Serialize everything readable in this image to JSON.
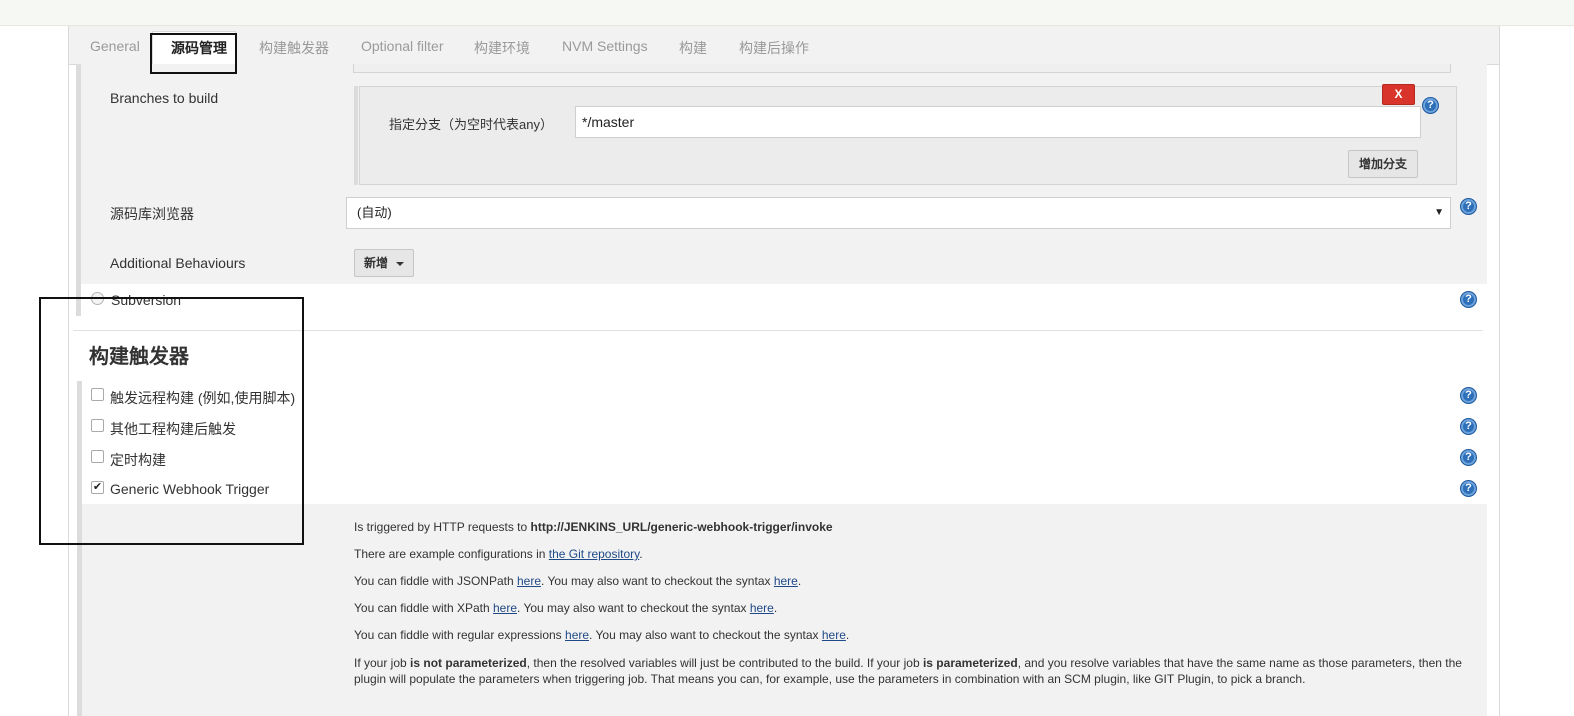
{
  "tabs": [
    {
      "label": "General",
      "active": false
    },
    {
      "label": "源码管理",
      "active": true
    },
    {
      "label": "构建触发器",
      "active": false
    },
    {
      "label": "Optional filter",
      "active": false
    },
    {
      "label": "构建环境",
      "active": false
    },
    {
      "label": "NVM Settings",
      "active": false
    },
    {
      "label": "构建",
      "active": false
    },
    {
      "label": "构建后操作",
      "active": false
    }
  ],
  "scm": {
    "branches_label": "Branches to build",
    "delete_button": "X",
    "branch_spec_label": "指定分支（为空时代表any）",
    "branch_spec_value": "*/master",
    "add_branch_button": "增加分支",
    "repo_browser_label": "源码库浏览器",
    "repo_browser_value": "(自动)",
    "additional_behaviours_label": "Additional Behaviours",
    "add_button": "新增",
    "subversion_label": "Subversion",
    "subversion_selected": false
  },
  "triggers": {
    "title": "构建触发器",
    "items": [
      {
        "label": "触发远程构建 (例如,使用脚本)",
        "checked": false
      },
      {
        "label": "其他工程构建后触发",
        "checked": false
      },
      {
        "label": "定时构建",
        "checked": false
      },
      {
        "label": "Generic Webhook Trigger",
        "checked": true
      }
    ]
  },
  "webhook_info": {
    "line1_prefix": "Is triggered by HTTP requests to ",
    "line1_url": "http://JENKINS_URL/generic-webhook-trigger/invoke",
    "line2_prefix": "There are example configurations in ",
    "line2_link": "the Git repository",
    "line2_suffix": ".",
    "line3_prefix": "You can fiddle with JSONPath ",
    "line3_link1": "here",
    "line3_mid": ". You may also want to checkout the syntax ",
    "line3_link2": "here",
    "line3_suffix": ".",
    "line4_prefix": "You can fiddle with XPath ",
    "line4_link1": "here",
    "line4_mid": ". You may also want to checkout the syntax ",
    "line4_link2": "here",
    "line4_suffix": ".",
    "line5_prefix": "You can fiddle with regular expressions ",
    "line5_link1": "here",
    "line5_mid": ". You may also want to checkout the syntax ",
    "line5_link2": "here",
    "line5_suffix": ".",
    "line6_a": "If your job ",
    "line6_b": "is not parameterized",
    "line6_c": ", then the resolved variables will just be contributed to the build. If your job ",
    "line6_d": "is parameterized",
    "line6_e": ", and you resolve variables that have the same name as those parameters, then the plugin will populate the parameters when triggering job. That means you can, for example, use the parameters in combination with an SCM plugin, like GIT Plugin, to pick a branch."
  },
  "help_icon_glyph": "?",
  "colors": {
    "delete_button": "#d9342b",
    "help_icon": "#2d6fb8",
    "link": "#204a87",
    "section_bg": "#f2f2f2"
  }
}
